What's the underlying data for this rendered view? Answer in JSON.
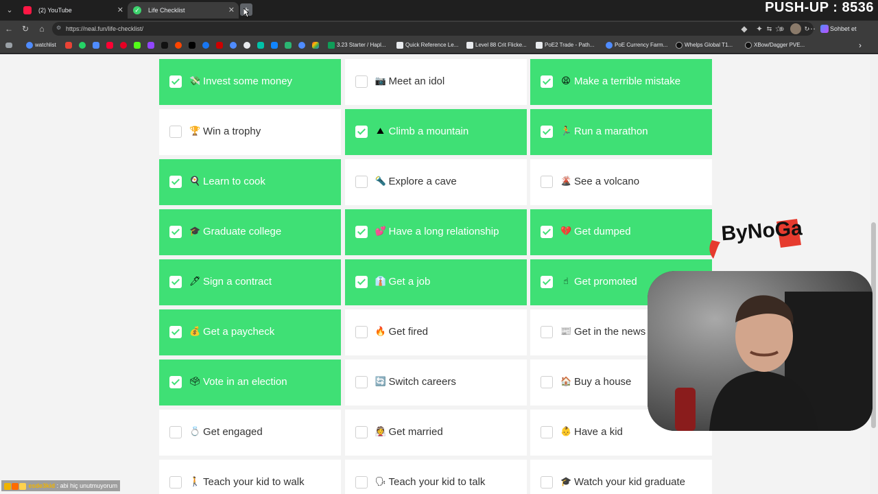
{
  "tabs": [
    {
      "title": "(2) YouTube",
      "favicon": "youtube-icon",
      "active": false
    },
    {
      "title": "Life Checklist",
      "favicon": "checkmark-icon",
      "active": true
    }
  ],
  "overlay_counter": "PUSH-UP : 8536",
  "address_bar": {
    "url": "https://neal.fun/life-checklist/"
  },
  "profile_button": "Sohbet et",
  "bookmarks": [
    {
      "label": "watchlist",
      "icon": "globe-icon"
    },
    {
      "label": "3.23 Starter / Hapl...",
      "icon": "sheet-icon"
    },
    {
      "label": "Quick Reference Le...",
      "icon": "doc-icon"
    },
    {
      "label": "Level 88 Crit Flicke...",
      "icon": "doc-icon"
    },
    {
      "label": "PoE2 Trade - Path...",
      "icon": "doc-icon"
    },
    {
      "label": "PoE Currency Farm...",
      "icon": "globe-icon"
    },
    {
      "label": "Whelps Global T1...",
      "icon": "globe-icon"
    },
    {
      "label": "XBow/Dagger PVE...",
      "icon": "globe-icon"
    }
  ],
  "checklist": {
    "items": [
      {
        "label": "Invest some money",
        "emoji": "💸",
        "checked": true
      },
      {
        "label": "Meet an idol",
        "emoji": "📷",
        "checked": false
      },
      {
        "label": "Make a terrible mistake",
        "emoji": "😫",
        "checked": true
      },
      {
        "label": "Win a trophy",
        "emoji": "🏆",
        "checked": false
      },
      {
        "label": "Climb a mountain",
        "emoji": "⛰",
        "checked": true
      },
      {
        "label": "Run a marathon",
        "emoji": "🏃",
        "checked": true
      },
      {
        "label": "Learn to cook",
        "emoji": "🍳",
        "checked": true
      },
      {
        "label": "Explore a cave",
        "emoji": "🔦",
        "checked": false
      },
      {
        "label": "See a volcano",
        "emoji": "🌋",
        "checked": false
      },
      {
        "label": "Graduate college",
        "emoji": "🎓",
        "checked": true
      },
      {
        "label": "Have a long relationship",
        "emoji": "💕",
        "checked": true
      },
      {
        "label": "Get dumped",
        "emoji": "💔",
        "checked": true
      },
      {
        "label": "Sign a contract",
        "emoji": "🖊",
        "checked": true
      },
      {
        "label": "Get a job",
        "emoji": "👔",
        "checked": true
      },
      {
        "label": "Get promoted",
        "emoji": "☝",
        "checked": true
      },
      {
        "label": "Get a paycheck",
        "emoji": "💰",
        "checked": true
      },
      {
        "label": "Get fired",
        "emoji": "🔥",
        "checked": false
      },
      {
        "label": "Get in the news",
        "emoji": "📰",
        "checked": false
      },
      {
        "label": "Vote in an election",
        "emoji": "🗳",
        "checked": true
      },
      {
        "label": "Switch careers",
        "emoji": "🔄",
        "checked": false
      },
      {
        "label": "Buy a house",
        "emoji": "🏠",
        "checked": false
      },
      {
        "label": "Get engaged",
        "emoji": "💍",
        "checked": false
      },
      {
        "label": "Get married",
        "emoji": "👰",
        "checked": false
      },
      {
        "label": "Have a kid",
        "emoji": "👶",
        "checked": false
      },
      {
        "label": "Teach your kid to walk",
        "emoji": "🚶",
        "checked": false
      },
      {
        "label": "Teach your kid to talk",
        "emoji": "🗣",
        "checked": false
      },
      {
        "label": "Watch your kid graduate",
        "emoji": "🎓",
        "checked": false
      }
    ]
  },
  "stream_logo_text": "ByNoGa",
  "chat": {
    "user": "esde3kid",
    "message": ": abi hiç unutmuyorum"
  }
}
